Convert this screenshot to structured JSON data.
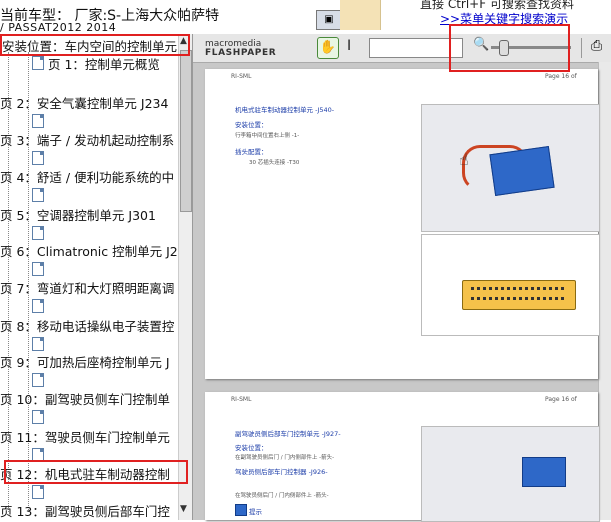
{
  "header": {
    "car_line1": "当前车型：  厂家:S-上海大众帕萨特",
    "car_line2": "/ PASSAT2012 2014",
    "hint_line1": "直接 Ctrl+F 可搜索查找资料",
    "hint_link": ">>菜单关键字搜索演示"
  },
  "tree": {
    "location_row": "安装位置：车内空间的控制单元",
    "items": [
      "页 1：控制单元概览",
      "页 2：安全气囊控制单元 J234",
      "页 3：端子 / 发动机起动控制系",
      "页 4：舒适 / 便利功能系统的中",
      "页 5：空调器控制单元 J301",
      "页 6：Climatronic 控制单元 J2",
      "页 7：弯道灯和大灯照明距离调",
      "页 8：移动电话操纵电子装置控",
      "页 9：可加热后座椅控制单元 J",
      "页 10：副驾驶员侧车门控制单",
      "页 11：驾驶员侧车门控制单元",
      "页 12：机电式驻车制动器控制",
      "页 13：副驾驶员侧后部车门控"
    ]
  },
  "viewer": {
    "logo_small": "macromedia",
    "logo_big": "FLASHPAPER",
    "page1": {
      "header_left": "RI-SML",
      "header_right": "Page 16 of",
      "title": "机电式驻车制动器控制单元 -J540-",
      "install_label": "安装位置：",
      "install_text": "行李箱中间位置右上侧 -1-",
      "plug_label": "插头配置：",
      "plug_text": "30 芯插头连接 -T30"
    },
    "page2": {
      "header_left": "RI-SML",
      "header_right": "Page 16 of",
      "title1": "副驾驶员侧后部车门控制单元 -J927-",
      "install_label": "安装位置：",
      "install_text1": "在副驾驶员侧后门 / 门内侧部件上 -箭头-",
      "title2": "驾驶员侧后部车门控制器 -J926-",
      "install_text2": "在驾驶员侧后门 / 门内侧部件上 -箭头-",
      "note": "提示"
    }
  }
}
